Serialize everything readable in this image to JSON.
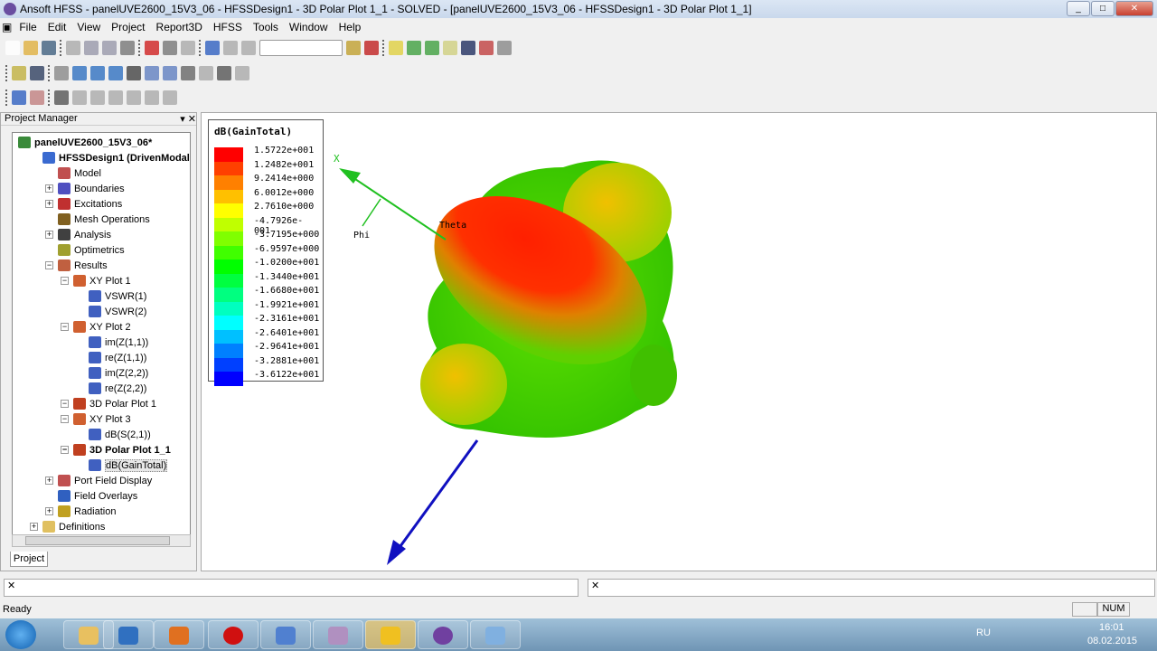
{
  "window": {
    "title": "Ansoft HFSS - panelUVE2600_15V3_06 - HFSSDesign1 - 3D Polar Plot 1_1 - SOLVED - [panelUVE2600_15V3_06 - HFSSDesign1 - 3D Polar Plot 1_1]"
  },
  "menu": [
    "File",
    "Edit",
    "View",
    "Project",
    "Report3D",
    "HFSS",
    "Tools",
    "Window",
    "Help"
  ],
  "project_manager": {
    "title": "Project Manager",
    "tab": "Project",
    "tree": [
      {
        "label": "panelUVE2600_15V3_06*",
        "level": 0,
        "bold": true,
        "color": "#3a8a3a"
      },
      {
        "label": "HFSSDesign1 (DrivenModal",
        "level": 1,
        "bold": true,
        "color": "#3a6ad0"
      },
      {
        "label": "Model",
        "level": 2,
        "color": "#c05050"
      },
      {
        "label": "Boundaries",
        "level": 2,
        "color": "#5050c0",
        "exp": true
      },
      {
        "label": "Excitations",
        "level": 2,
        "color": "#c03030",
        "exp": true
      },
      {
        "label": "Mesh Operations",
        "level": 2,
        "color": "#806020"
      },
      {
        "label": "Analysis",
        "level": 2,
        "color": "#404040",
        "exp": true
      },
      {
        "label": "Optimetrics",
        "level": 2,
        "color": "#a0a030"
      },
      {
        "label": "Results",
        "level": 2,
        "color": "#c06040",
        "exp": true
      },
      {
        "label": "XY Plot 1",
        "level": 3,
        "color": "#d06030",
        "exp": true
      },
      {
        "label": "VSWR(1)",
        "level": 4,
        "color": "#4060c0"
      },
      {
        "label": "VSWR(2)",
        "level": 4,
        "color": "#4060c0"
      },
      {
        "label": "XY Plot 2",
        "level": 3,
        "color": "#d06030",
        "exp": true
      },
      {
        "label": "im(Z(1,1))",
        "level": 4,
        "color": "#4060c0"
      },
      {
        "label": "re(Z(1,1))",
        "level": 4,
        "color": "#4060c0"
      },
      {
        "label": "im(Z(2,2))",
        "level": 4,
        "color": "#4060c0"
      },
      {
        "label": "re(Z(2,2))",
        "level": 4,
        "color": "#4060c0"
      },
      {
        "label": "3D Polar Plot 1",
        "level": 3,
        "color": "#c04020",
        "exp": true
      },
      {
        "label": "XY Plot 3",
        "level": 3,
        "color": "#d06030",
        "exp": true
      },
      {
        "label": "dB(S(2,1))",
        "level": 4,
        "color": "#4060c0"
      },
      {
        "label": "3D Polar Plot 1_1",
        "level": 3,
        "bold": true,
        "color": "#c04020",
        "exp": true
      },
      {
        "label": "dB(GainTotal)",
        "level": 4,
        "color": "#4060c0",
        "selected": true
      },
      {
        "label": "Port Field Display",
        "level": 2,
        "color": "#c05050",
        "exp": true
      },
      {
        "label": "Field Overlays",
        "level": 2,
        "color": "#3060c0"
      },
      {
        "label": "Radiation",
        "level": 2,
        "color": "#c0a020",
        "exp": true
      },
      {
        "label": "Definitions",
        "level": 1,
        "color": "#e0c060",
        "exp": true
      }
    ]
  },
  "legend": {
    "title": "dB(GainTotal)",
    "entries": [
      {
        "value": "1.5722e+001",
        "color": "#ff0000"
      },
      {
        "value": "1.2482e+001",
        "color": "#ff4000"
      },
      {
        "value": "9.2414e+000",
        "color": "#ff8000"
      },
      {
        "value": "6.0012e+000",
        "color": "#ffc000"
      },
      {
        "value": "2.7610e+000",
        "color": "#ffff00"
      },
      {
        "value": "-4.7926e-001",
        "color": "#c0ff00"
      },
      {
        "value": "-3.7195e+000",
        "color": "#80ff00"
      },
      {
        "value": "-6.9597e+000",
        "color": "#40ff00"
      },
      {
        "value": "-1.0200e+001",
        "color": "#00ff00"
      },
      {
        "value": "-1.3440e+001",
        "color": "#00ff40"
      },
      {
        "value": "-1.6680e+001",
        "color": "#00ff80"
      },
      {
        "value": "-1.9921e+001",
        "color": "#00ffc0"
      },
      {
        "value": "-2.3161e+001",
        "color": "#00ffff"
      },
      {
        "value": "-2.6401e+001",
        "color": "#00c0ff"
      },
      {
        "value": "-2.9641e+001",
        "color": "#0080ff"
      },
      {
        "value": "-3.2881e+001",
        "color": "#0040ff"
      },
      {
        "value": "-3.6122e+001",
        "color": "#0000ff"
      }
    ]
  },
  "axes": {
    "x": "X",
    "phi": "Phi",
    "theta": "Theta"
  },
  "status": {
    "text": "Ready",
    "num": "NUM"
  },
  "taskbar": {
    "lang": "RU",
    "time": "16:01",
    "date": "08.02.2015"
  }
}
